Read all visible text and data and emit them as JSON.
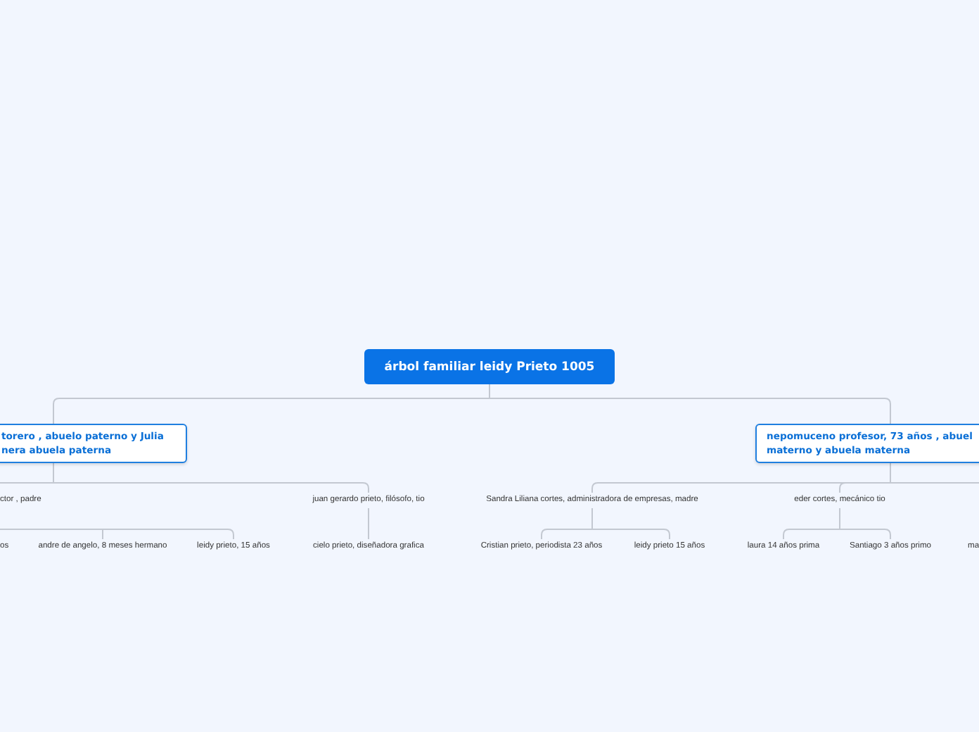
{
  "root": {
    "title": "árbol familiar leidy Prieto 1005",
    "children": [
      {
        "text": "torero , abuelo paterno y Julia\nnera abuela paterna",
        "children": [
          {
            "text": "ctor , padre",
            "children": [
              {
                "text": "os"
              },
              {
                "text": "andre de angelo, 8 meses hermano"
              },
              {
                "text": "leidy prieto, 15 años"
              }
            ]
          },
          {
            "text": "juan gerardo prieto, filósofo, tio",
            "children": [
              {
                "text": "cielo prieto, diseñadora grafica"
              }
            ]
          }
        ]
      },
      {
        "text": "nepomuceno profesor, 73 años , abuel\nmaterno y abuela materna",
        "children": [
          {
            "text": "Sandra Liliana cortes, administradora de empresas, madre",
            "children": [
              {
                "text": "Cristian prieto, periodista 23 años"
              },
              {
                "text": "leidy prieto 15 años"
              }
            ]
          },
          {
            "text": "eder cortes, mecánico tio",
            "children": [
              {
                "text": "laura 14 años prima"
              },
              {
                "text": "Santiago 3 años primo"
              }
            ]
          },
          {
            "children": [
              {
                "text": "ma"
              }
            ]
          }
        ]
      }
    ]
  }
}
